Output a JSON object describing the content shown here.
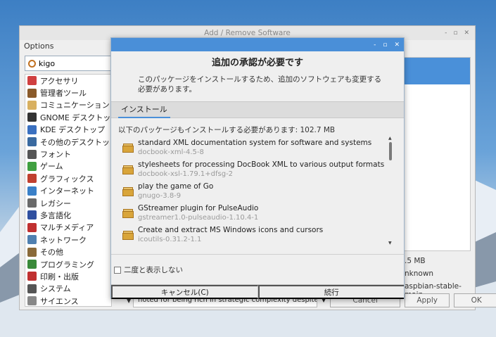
{
  "main_window": {
    "title": "Add / Remove Software",
    "controls": [
      "-",
      "▫",
      "✕"
    ],
    "options_label": "Options",
    "search_value": "kigo",
    "categories": [
      {
        "label": "アクセサリ",
        "color": "#d04040"
      },
      {
        "label": "管理者ツール",
        "color": "#8a5a2a"
      },
      {
        "label": "コミュニケーション",
        "color": "#d8b060"
      },
      {
        "label": "GNOME デスクトップ",
        "color": "#333333"
      },
      {
        "label": "KDE デスクトップ",
        "color": "#3a70c0"
      },
      {
        "label": "その他のデスクトップ",
        "color": "#3a6aa0"
      },
      {
        "label": "フォント",
        "color": "#555555"
      },
      {
        "label": "ゲーム",
        "color": "#40a040"
      },
      {
        "label": "グラフィックス",
        "color": "#c04030"
      },
      {
        "label": "インターネット",
        "color": "#3a80c8"
      },
      {
        "label": "レガシー",
        "color": "#6a6a6a"
      },
      {
        "label": "多言語化",
        "color": "#3050a0"
      },
      {
        "label": "マルチメディア",
        "color": "#c03030"
      },
      {
        "label": "ネットワーク",
        "color": "#5080b0"
      },
      {
        "label": "その他",
        "color": "#8a6a3a"
      },
      {
        "label": "プログラミング",
        "color": "#3a8a3a"
      },
      {
        "label": "印刷・出版",
        "color": "#c03030"
      },
      {
        "label": "システム",
        "color": "#555555"
      },
      {
        "label": "サイエンス",
        "color": "#888888"
      }
    ],
    "size_text": ".5 MB",
    "unknown_text": "nknown",
    "repo_text": "aspbian-stable-main",
    "description_snippet": "noted for being rich in strategic complexity despite",
    "cancel_label": "Cancel",
    "apply_label": "Apply",
    "ok_label": "OK"
  },
  "dialog": {
    "controls": [
      "-",
      "▫",
      "✕"
    ],
    "heading": "追加の承認が必要です",
    "message": "このパッケージをインストールするため、追加のソフトウェアも変更する必要があります。",
    "tab_label": "インストール",
    "requirement_text": "以下のパッケージもインストールする必要があります: 102.7 MB",
    "packages": [
      {
        "title": "standard XML documentation system for software and systems",
        "sub": "docbook-xml-4.5-8"
      },
      {
        "title": "stylesheets for processing DocBook XML to various output formats",
        "sub": "docbook-xsl-1.79.1+dfsg-2"
      },
      {
        "title": "play the game of Go",
        "sub": "gnugo-3.8-9"
      },
      {
        "title": "GStreamer plugin for PulseAudio",
        "sub": "gstreamer1.0-pulseaudio-1.10.4-1"
      },
      {
        "title": "Create and extract MS Windows icons and cursors",
        "sub": "icoutils-0.31.2-1.1"
      }
    ],
    "dont_show_label": "二度と表示しない",
    "cancel_label": "キャンセル(C)",
    "continue_label": "続行"
  },
  "colors": {
    "accent": "#4a90d9",
    "dialog_titlebar": "#4a8fd8"
  }
}
